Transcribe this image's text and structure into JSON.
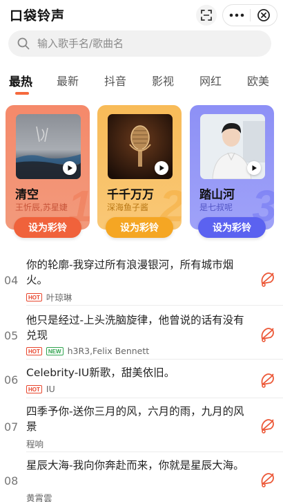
{
  "app": {
    "title": "口袋铃声"
  },
  "search": {
    "placeholder": "输入歌手名/歌曲名"
  },
  "tabs": [
    {
      "label": "最热",
      "active": true
    },
    {
      "label": "最新",
      "active": false
    },
    {
      "label": "抖音",
      "active": false
    },
    {
      "label": "影视",
      "active": false
    },
    {
      "label": "网红",
      "active": false
    },
    {
      "label": "欧美",
      "active": false
    }
  ],
  "top_cards": [
    {
      "rank": "1",
      "song": "清空",
      "artist": "王忻辰,苏星婕",
      "button": "设为彩铃",
      "color": "#f0623b"
    },
    {
      "rank": "2",
      "song": "千千万万",
      "artist": "深海鱼子酱",
      "button": "设为彩铃",
      "color": "#f5a623"
    },
    {
      "rank": "3",
      "song": "踏山河",
      "artist": "是七叔呢",
      "button": "设为彩铃",
      "color": "#5b62f0"
    }
  ],
  "list": [
    {
      "rank": "04",
      "title": "你的轮廓-我穿过所有浪漫银河，所有城市烟火。",
      "badges": [
        "HOT"
      ],
      "artist": "叶琼琳"
    },
    {
      "rank": "05",
      "title": "他只是经过-上头洗脑旋律，他曾说的话有没有兑现",
      "badges": [
        "HOT",
        "NEW"
      ],
      "artist": "h3R3,Felix Bennett"
    },
    {
      "rank": "06",
      "title": "Celebrity-IU新歌，甜美依旧。",
      "badges": [
        "HOT"
      ],
      "artist": "IU"
    },
    {
      "rank": "07",
      "title": "四季予你-送你三月的风，六月的雨，九月的风景",
      "badges": [],
      "artist": "程响"
    },
    {
      "rank": "08",
      "title": "星辰大海-我向你奔赴而来，你就是星辰大海。",
      "badges": [],
      "artist": "黄霄雲"
    }
  ],
  "colors": {
    "accent": "#f5693d",
    "hot": "#e8452c",
    "new": "#2fa34e"
  },
  "icons": {
    "scan": "scan-icon",
    "more": "more-dots-icon",
    "close": "close-circle-icon",
    "search": "search-icon",
    "play": "play-icon",
    "ringtone": "ringtone-bell-icon"
  }
}
